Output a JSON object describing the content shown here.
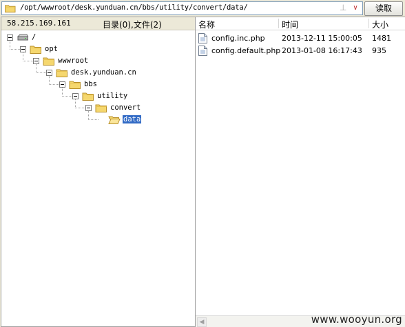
{
  "toolbar": {
    "path": "/opt/wwwroot/desk.yunduan.cn/bbs/utility/convert/data/",
    "add_icon": "⊥",
    "dropdown_icon": "∨",
    "read_button": "读取"
  },
  "left": {
    "ip": "58.215.169.161",
    "counts": "目录(0),文件(2)",
    "tree": [
      {
        "label": "/",
        "level": 0,
        "icon": "drive-icon"
      },
      {
        "label": "opt",
        "level": 1,
        "icon": "folder-icon"
      },
      {
        "label": "wwwroot",
        "level": 2,
        "icon": "folder-icon"
      },
      {
        "label": "desk.yunduan.cn",
        "level": 3,
        "icon": "folder-icon"
      },
      {
        "label": "bbs",
        "level": 4,
        "icon": "folder-icon"
      },
      {
        "label": "utility",
        "level": 5,
        "icon": "folder-icon"
      },
      {
        "label": "convert",
        "level": 6,
        "icon": "folder-icon"
      },
      {
        "label": "data",
        "level": 7,
        "icon": "open-folder-icon",
        "selected": true
      }
    ]
  },
  "right": {
    "columns": [
      "名称",
      "时间",
      "大小"
    ],
    "files": [
      {
        "name": "config.inc.php",
        "time": "2013-12-11 15:00:05",
        "size": "1481"
      },
      {
        "name": "config.default.php",
        "time": "2013-01-08 16:17:43",
        "size": "935"
      }
    ]
  },
  "watermark": "www.wooyun.org",
  "colors": {
    "selection": "#316ac5",
    "folder": "#f5d76e",
    "chrome": "#ece9d8"
  }
}
